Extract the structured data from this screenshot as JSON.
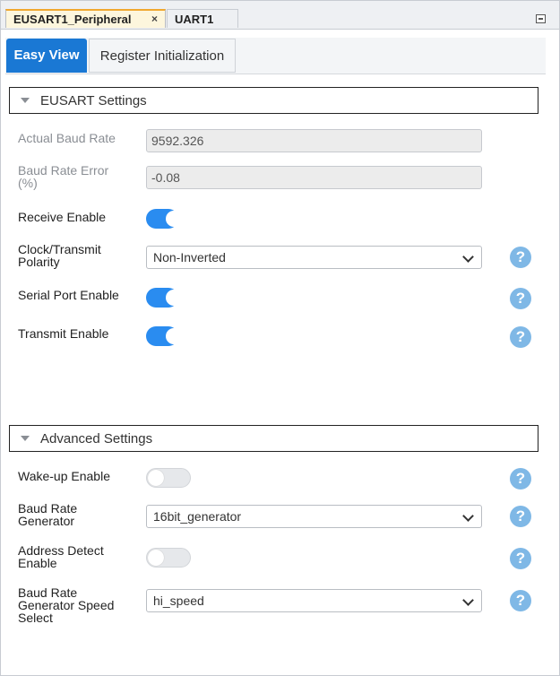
{
  "tabs": {
    "active_label": "EUSART1_Peripheral",
    "close_symbol": "×",
    "inactive_label": "UART1"
  },
  "view_tabs": {
    "easy_view": "Easy View",
    "register_init": "Register Initialization"
  },
  "eusart_settings": {
    "title": "EUSART Settings",
    "actual_baud_rate": {
      "label": "Actual Baud Rate",
      "value": "9592.326"
    },
    "baud_rate_error": {
      "label_line1": "Baud Rate Error",
      "label_line2": "(%)",
      "value": "-0.08"
    },
    "receive_enable": {
      "label": "Receive Enable",
      "on": true
    },
    "clock_polarity": {
      "label_line1": "Clock/Transmit",
      "label_line2": "Polarity",
      "value": "Non-Inverted"
    },
    "serial_port_enable": {
      "label": "Serial Port Enable",
      "on": true
    },
    "transmit_enable": {
      "label": "Transmit Enable",
      "on": true
    }
  },
  "advanced_settings": {
    "title": "Advanced Settings",
    "wakeup_enable": {
      "label": "Wake-up Enable",
      "on": false
    },
    "baud_rate_generator": {
      "label_line1": "Baud Rate",
      "label_line2": "Generator",
      "value": "16bit_generator"
    },
    "address_detect_enable": {
      "label_line1": "Address Detect",
      "label_line2": "Enable",
      "on": false
    },
    "baud_rate_speed": {
      "label_line1": "Baud Rate",
      "label_line2": "Generator Speed",
      "label_line3": "Select",
      "value": "hi_speed"
    }
  },
  "help_glyph": "?",
  "colors": {
    "accent": "#1a78d4",
    "toggle_on": "#2a8cf0",
    "help_icon": "#7fb8e6",
    "active_tab_top": "#f0a830"
  }
}
